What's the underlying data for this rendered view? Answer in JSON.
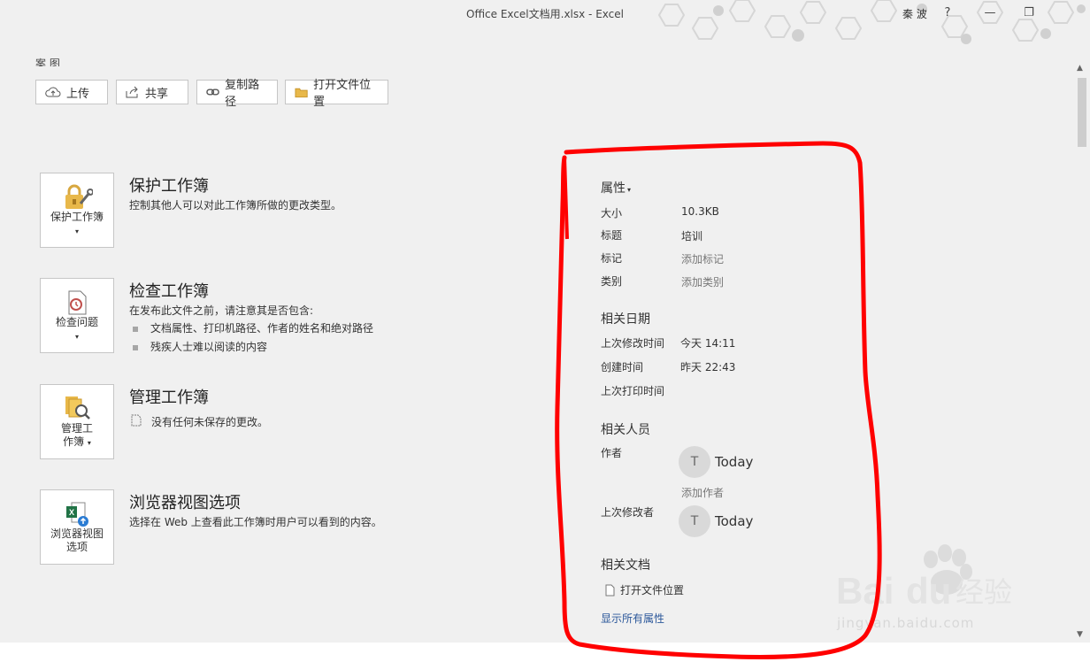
{
  "window": {
    "title": "Office Excel文档用.xlsx  -  Excel",
    "user": "秦 波",
    "help": "?",
    "minimize": "—",
    "restore": "❐"
  },
  "top": {
    "partial_label": "案 图",
    "buttons": [
      {
        "label": "上传",
        "icon": "cloud-upload-icon"
      },
      {
        "label": "共享",
        "icon": "share-icon"
      },
      {
        "label": "复制路径",
        "icon": "link-icon"
      },
      {
        "label": "打开文件位置",
        "icon": "folder-icon"
      }
    ]
  },
  "sections": {
    "protect": {
      "icon_label": "保护工作簿",
      "title": "保护工作簿",
      "desc": "控制其他人可以对此工作簿所做的更改类型。"
    },
    "inspect": {
      "icon_label": "检查问题",
      "title": "检查工作簿",
      "desc": "在发布此文件之前，请注意其是否包含:",
      "bullets": [
        "文档属性、打印机路径、作者的姓名和绝对路径",
        "残疾人士难以阅读的内容"
      ]
    },
    "manage": {
      "icon_label_1": "管理工",
      "icon_label_2": "作簿",
      "title": "管理工作簿",
      "desc": "没有任何未保存的更改。"
    },
    "browser": {
      "icon_label_1": "浏览器视图",
      "icon_label_2": "选项",
      "title": "浏览器视图选项",
      "desc": "选择在 Web 上查看此工作簿时用户可以看到的内容。"
    }
  },
  "properties": {
    "header": "属性",
    "size_label": "大小",
    "size_value": "10.3KB",
    "title_label": "标题",
    "title_value": "培训",
    "tags_label": "标记",
    "tags_value": "添加标记",
    "category_label": "类别",
    "category_value": "添加类别"
  },
  "dates": {
    "header": "相关日期",
    "modified_label": "上次修改时间",
    "modified_value": "今天 14:11",
    "created_label": "创建时间",
    "created_value": "昨天 22:43",
    "printed_label": "上次打印时间"
  },
  "people": {
    "header": "相关人员",
    "author_label": "作者",
    "author_initial": "T",
    "author_name": "Today",
    "add_author": "添加作者",
    "modifier_label": "上次修改者",
    "modifier_initial": "T",
    "modifier_name": "Today"
  },
  "docs": {
    "header": "相关文档",
    "open_location": "打开文件位置",
    "show_all": "显示所有属性"
  },
  "watermark": {
    "text": "jingyan.baidu.com"
  },
  "colors": {
    "annotation": "#ff0000",
    "link": "#2b579a"
  }
}
